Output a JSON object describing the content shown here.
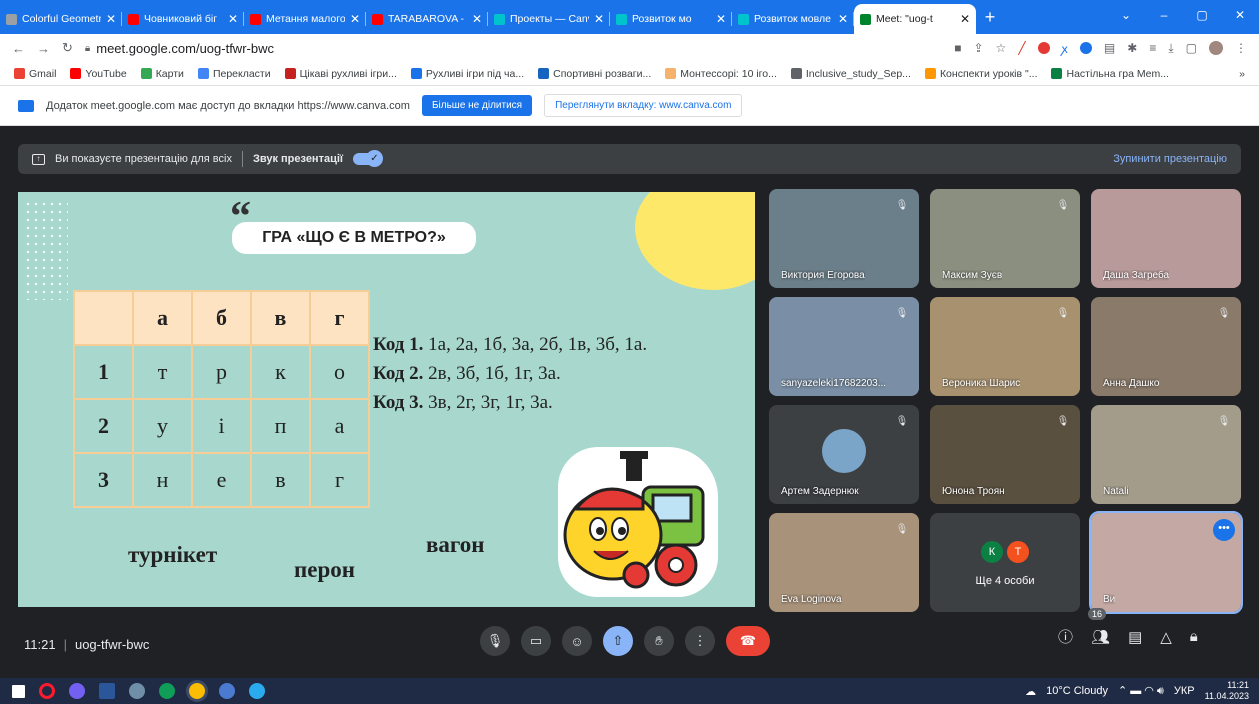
{
  "tabs": [
    {
      "title": "Colorful Geometr",
      "color": "#9aa0a6"
    },
    {
      "title": "Човниковий біг",
      "color": "#ff0000"
    },
    {
      "title": "Метання малого",
      "color": "#ff0000"
    },
    {
      "title": "TARABAROVA - P",
      "color": "#ff0000"
    },
    {
      "title": "Проекты — Canv",
      "color": "#00c4cc"
    },
    {
      "title": "Розвиток мо",
      "color": "#00c4cc"
    },
    {
      "title": "Розвиток мовле",
      "color": "#00c4cc"
    },
    {
      "title": "Meet: \"uog-t",
      "color": "#00832d"
    }
  ],
  "url": "meet.google.com/uog-tfwr-bwc",
  "bookmarks": [
    "Gmail",
    "YouTube",
    "Карти",
    "Перекласти",
    "Цікаві рухливі ігри...",
    "Рухливі ігри під ча...",
    "Спортивні розваги...",
    "Монтессорі: 10 іго...",
    "Inclusive_study_Sep...",
    "Конспекти уроків \"...",
    "Настільна гра Mem..."
  ],
  "sharebar": {
    "text": "Додаток meet.google.com має доступ до вкладки https://www.canva.com",
    "stop_share": "Більше не ділитися",
    "view_tab": "Переглянути вкладку: www.canva.com"
  },
  "presenting": {
    "text": "Ви показуєте презентацію для всіх",
    "audio": "Звук презентації",
    "stop": "Зупинити презентацію"
  },
  "slide": {
    "title": "ГРА «ЩО Є В МЕТРО?»",
    "header": [
      "",
      "а",
      "б",
      "в",
      "г"
    ],
    "rows": [
      [
        "1",
        "т",
        "р",
        "к",
        "о"
      ],
      [
        "2",
        "у",
        "і",
        "п",
        "а"
      ],
      [
        "3",
        "н",
        "е",
        "в",
        "г"
      ]
    ],
    "codes": [
      {
        "label": "Код 1.",
        "text": " 1а, 2а, 1б, 3а, 2б, 1в, 3б, 1а."
      },
      {
        "label": "Код 2.",
        "text": " 2в, 3б, 1б, 1г, 3а."
      },
      {
        "label": "Код 3.",
        "text": " 3в, 2г, 3г, 1г, 3а."
      }
    ],
    "words": [
      "турнікет",
      "перон",
      "вагон"
    ]
  },
  "participants": [
    {
      "name": "Виктория Егорова",
      "bg": "#6b7f8a"
    },
    {
      "name": "Максим Зуєв",
      "bg": "#8a8f80"
    },
    {
      "name": "Даша Загреба",
      "bg": "#b89a9a"
    },
    {
      "name": "sanyazeleki17682203...",
      "bg": "#7a8fa5"
    },
    {
      "name": "Вероника Шарис",
      "bg": "#a8916f"
    },
    {
      "name": "Анна Дашко",
      "bg": "#8a7a6a"
    },
    {
      "name": "Артем Задернюк",
      "bg": "#3c4043"
    },
    {
      "name": "Юнона Троян",
      "bg": "#5a5040"
    },
    {
      "name": "Natali",
      "bg": "#a39c8a"
    },
    {
      "name": "Eva Loginova",
      "bg": "#a8927a"
    },
    {
      "name": "Ще 4 особи",
      "bg": "#3c4043"
    },
    {
      "name": "Ви",
      "bg": "#c4a8a4"
    }
  ],
  "more_avatars": [
    {
      "letter": "К",
      "color": "#0b8043"
    },
    {
      "letter": "Т",
      "color": "#f4511e"
    }
  ],
  "meeting": {
    "time": "11:21",
    "code": "uog-tfwr-bwc",
    "count": "16"
  },
  "taskbar": {
    "weather": "10°C  Cloudy",
    "lang": "УКР",
    "time": "11:21",
    "date": "11.04.2023"
  }
}
